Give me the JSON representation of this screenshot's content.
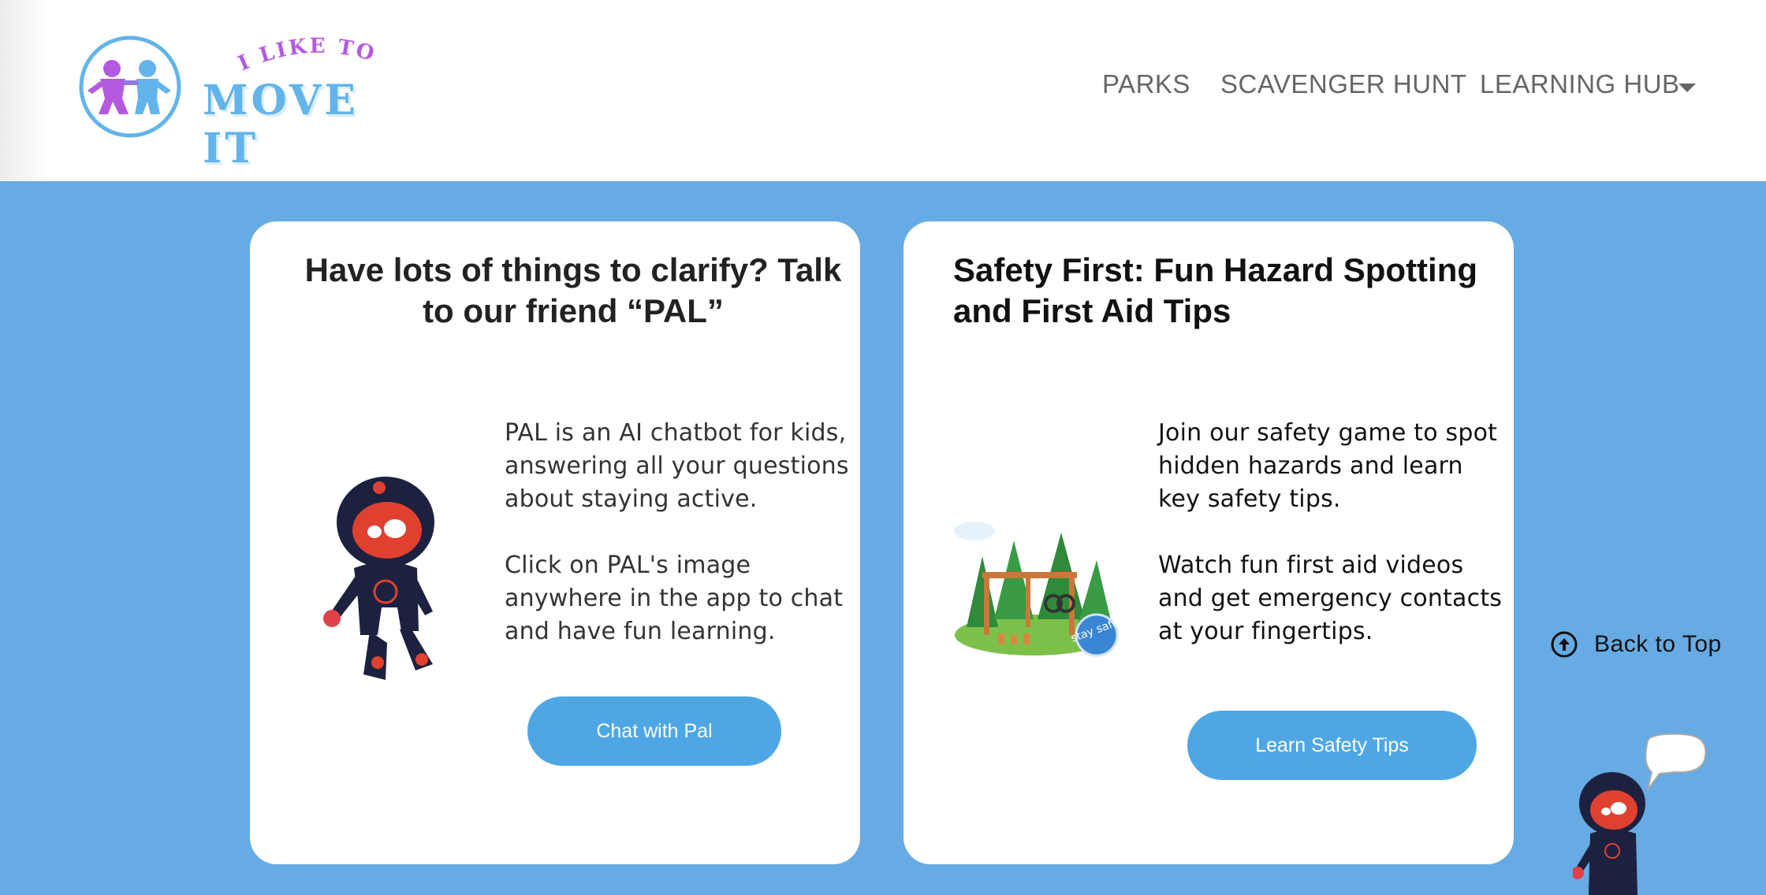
{
  "header": {
    "logo_tagline": "I LIKE TO",
    "logo_title": "MOVE IT",
    "nav": [
      {
        "label": "PARKS"
      },
      {
        "label": "SCAVENGER HUNT"
      },
      {
        "label": "LEARNING HUB"
      }
    ]
  },
  "cards": {
    "pal": {
      "title": "Have lots of things to clarify? Talk to our friend “PAL”",
      "para1": "PAL is an AI chatbot for kids, answering all your questions about staying active.",
      "para2": "Click on PAL's image anywhere in the app to chat and have fun learning.",
      "button": "Chat with Pal"
    },
    "safety": {
      "title": "Safety First: Fun Hazard Spotting and First Aid Tips",
      "para1": "Join our safety game to spot hidden hazards and learn key safety tips.",
      "para2": "Watch fun first aid videos and get emergency contacts at your fingertips.",
      "button": "Learn Safety Tips",
      "badge_text": "stay safe"
    }
  },
  "back_to_top": "Back to Top",
  "colors": {
    "background": "#66ABE3",
    "button": "#4EA7E4",
    "logo_blue": "#62B4EA",
    "logo_purple": "#B35AE0"
  }
}
